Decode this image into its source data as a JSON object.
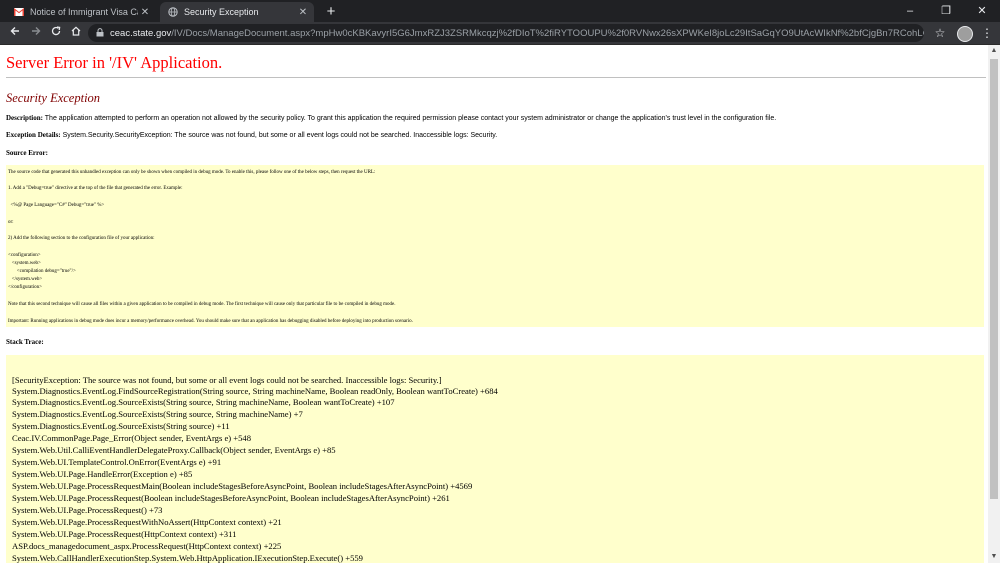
{
  "browser": {
    "tabs": [
      {
        "title": "Notice of Immigrant Visa Case C",
        "favicon": "gmail-icon",
        "active": false
      },
      {
        "title": "Security Exception",
        "favicon": "globe-icon",
        "active": true
      }
    ],
    "new_tab": "+",
    "window_controls": {
      "minimize": "–",
      "maximize": "❐",
      "close": "✕"
    },
    "url_host": "ceac.state.gov",
    "url_path": "/IV/Docs/ManageDocument.aspx?mpHw0cKBKavyrI5G6JmxRZJ3ZSRMkcqzj%2fDIoT%2fiRYTOOUPU%2f0RVNwx26sXPWKeI8joLc29ItSaGqYO9UtAcWIkNf%2bfCjgBn7RCohLCCNXmW7Cm...",
    "star": "☆",
    "menu": "⋮"
  },
  "page": {
    "title": "Server Error in '/IV' Application.",
    "subtitle": "Security Exception",
    "description_label": "Description:",
    "description_text": "The application attempted to perform an operation not allowed by the security policy.  To grant this application the required permission please contact your system administrator or change the application's trust level in the configuration file.",
    "exception_label": "Exception Details:",
    "exception_text": "System.Security.SecurityException: The source was not found, but some or all event logs could not be searched.  Inaccessible logs: Security.",
    "source_error_label": "Source Error:",
    "source_lines": [
      "The source code that generated this unhandled exception can only be shown when compiled in debug mode. To enable this, please follow one of the below steps, then request the URL:",
      "1. Add a \"Debug=true\" directive at the top of the file that generated the error. Example:",
      "  <%@ Page Language=\"C#\" Debug=\"true\" %>",
      "or:",
      "2) Add the following section to the configuration file of your application:",
      "<configuration>",
      "   <system.web>",
      "       <compilation debug=\"true\"/>",
      "   </system.web>",
      "</configuration>",
      "Note that this second technique will cause all files within a given application to be compiled in debug mode. The first technique will cause only that particular file to be compiled in debug mode.",
      "Important: Running applications in debug mode does incur a memory/performance overhead. You should make sure that an application has debugging disabled before deploying into production scenario."
    ],
    "stack_trace_label": "Stack Trace:",
    "stack_trace": [
      "[SecurityException: The source was not found, but some or all event logs could not be searched.  Inaccessible logs: Security.]",
      "   System.Diagnostics.EventLog.FindSourceRegistration(String source, String machineName, Boolean readOnly, Boolean wantToCreate) +684",
      "   System.Diagnostics.EventLog.SourceExists(String source, String machineName, Boolean wantToCreate) +107",
      "   System.Diagnostics.EventLog.SourceExists(String source, String machineName) +7",
      "   System.Diagnostics.EventLog.SourceExists(String source) +11",
      "   Ceac.IV.CommonPage.Page_Error(Object sender, EventArgs e) +548",
      "   System.Web.Util.CalliEventHandlerDelegateProxy.Callback(Object sender, EventArgs e) +85",
      "   System.Web.UI.TemplateControl.OnError(EventArgs e) +91",
      "   System.Web.UI.Page.HandleError(Exception e) +85",
      "   System.Web.UI.Page.ProcessRequestMain(Boolean includeStagesBeforeAsyncPoint, Boolean includeStagesAfterAsyncPoint) +4569",
      "   System.Web.UI.Page.ProcessRequest(Boolean includeStagesBeforeAsyncPoint, Boolean includeStagesAfterAsyncPoint) +261",
      "   System.Web.UI.Page.ProcessRequest() +73",
      "   System.Web.UI.Page.ProcessRequestWithNoAssert(HttpContext context) +21",
      "   System.Web.UI.Page.ProcessRequest(HttpContext context) +311",
      "   ASP.docs_managedocument_aspx.ProcessRequest(HttpContext context) +225",
      "   System.Web.CallHandlerExecutionStep.System.Web.HttpApplication.IExecutionStep.Execute() +559"
    ]
  },
  "colors": {
    "title_red": "#ff0000",
    "subtitle_maroon": "#800000",
    "code_bg": "#ffffcc",
    "chrome_dark": "#202124"
  }
}
